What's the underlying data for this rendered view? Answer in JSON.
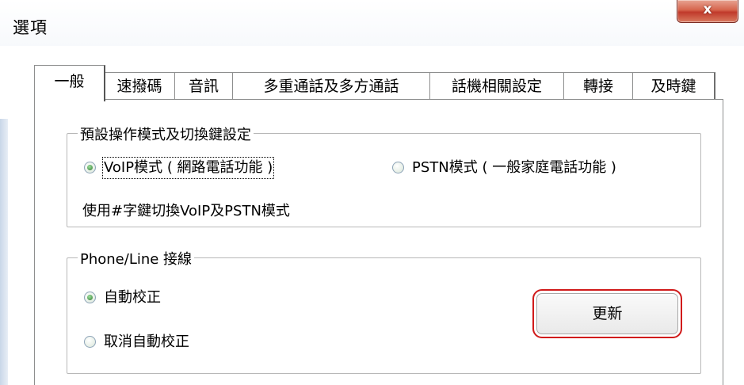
{
  "window": {
    "title": "選項",
    "close_glyph": "x"
  },
  "tabs": [
    {
      "label": "一般",
      "active": true
    },
    {
      "label": "速撥碼",
      "active": false
    },
    {
      "label": "音訊",
      "active": false
    },
    {
      "label": "多重通話及多方通話",
      "active": false
    },
    {
      "label": "話機相關設定",
      "active": false
    },
    {
      "label": "轉接",
      "active": false
    },
    {
      "label": "及時鍵",
      "active": false
    }
  ],
  "mode_group": {
    "title": "預設操作模式及切換鍵設定",
    "voip_label": "VoIP模式 ( 網路電話功能 )",
    "voip_selected": true,
    "pstn_label": "PSTN模式 ( 一般家庭電話功能 )",
    "pstn_selected": false,
    "hint": "使用#字鍵切換VoIP及PSTN模式"
  },
  "line_group": {
    "title": "Phone/Line 接線",
    "auto_label": "自動校正",
    "auto_selected": true,
    "cancel_label": "取消自動校正",
    "cancel_selected": false,
    "update_button": "更新"
  },
  "colors": {
    "close_button": "#c0392b",
    "highlight_border": "#d11a1a",
    "radio_selected": "#2f7a2f"
  }
}
